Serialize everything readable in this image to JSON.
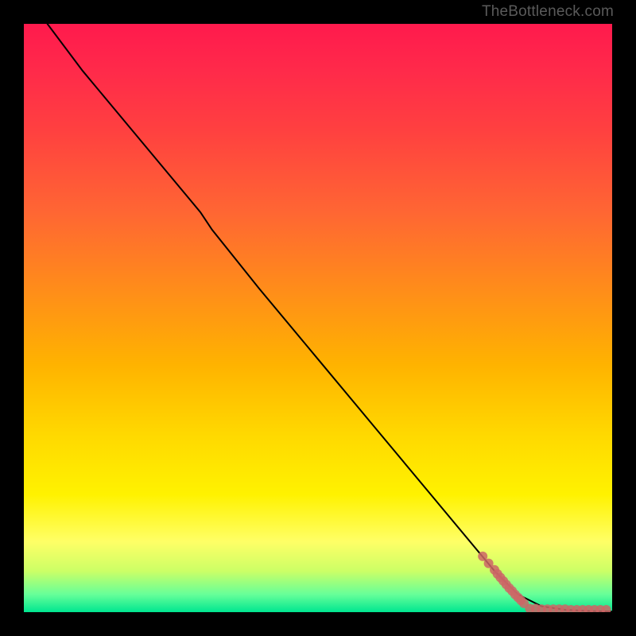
{
  "watermark": "TheBottleneck.com",
  "chart_data": {
    "type": "line",
    "title": "",
    "xlabel": "",
    "ylabel": "",
    "xlim": [
      0,
      100
    ],
    "ylim": [
      0,
      100
    ],
    "series": [
      {
        "name": "curve",
        "style": "line",
        "color": "#000000",
        "x": [
          4,
          10,
          20,
          30,
          32,
          40,
          50,
          60,
          70,
          80,
          84,
          88,
          92,
          96,
          100
        ],
        "y": [
          100,
          92,
          80,
          68,
          65,
          55,
          43,
          31,
          19,
          7,
          3,
          1,
          0.4,
          0.2,
          0.1
        ]
      },
      {
        "name": "points-descending",
        "style": "scatter",
        "color": "#cc6666",
        "x": [
          78,
          79,
          80,
          80.5,
          81,
          81.5,
          82,
          82.5,
          83,
          83.5,
          84,
          84.5,
          85
        ],
        "y": [
          9.5,
          8.3,
          7.2,
          6.5,
          5.9,
          5.3,
          4.7,
          4.1,
          3.6,
          3.0,
          2.5,
          2.0,
          1.5
        ]
      },
      {
        "name": "points-flat",
        "style": "scatter",
        "color": "#cc6666",
        "x": [
          86,
          87,
          88,
          89,
          90,
          91,
          92,
          93,
          94,
          95,
          96,
          97,
          98,
          99
        ],
        "y": [
          0.6,
          0.6,
          0.5,
          0.5,
          0.5,
          0.5,
          0.5,
          0.4,
          0.4,
          0.4,
          0.4,
          0.4,
          0.4,
          0.4
        ]
      }
    ]
  }
}
